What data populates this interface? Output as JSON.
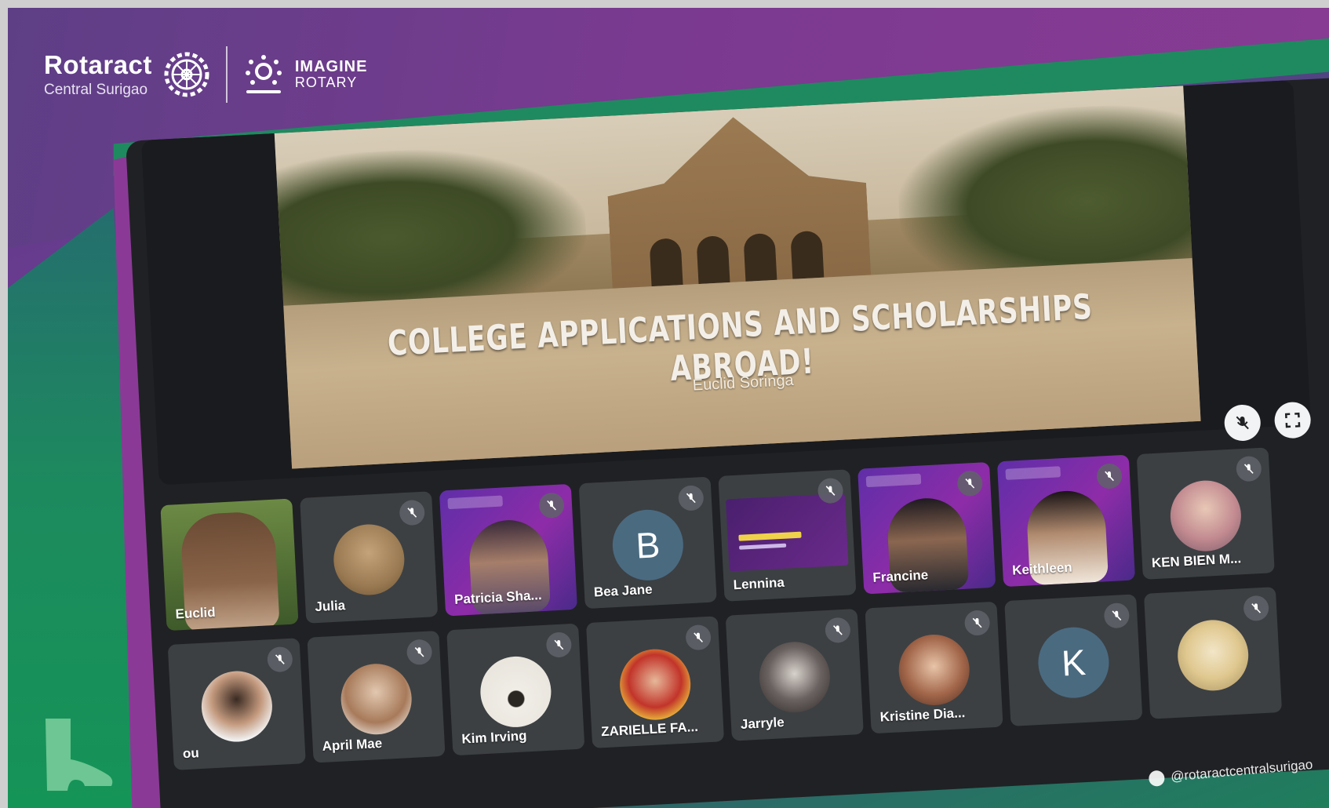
{
  "branding": {
    "org_name": "Rotaract",
    "org_location": "Central Surigao",
    "campaign_line1": "IMAGINE",
    "campaign_line2": "ROTARY"
  },
  "presentation": {
    "title": "COLLEGE APPLICATIONS AND SCHOLARSHIPS ABROAD!",
    "presenter": "Euclid Soringa"
  },
  "participants_row1": [
    {
      "name": "Euclid"
    },
    {
      "name": "Julia"
    },
    {
      "name": "Patricia Sha..."
    },
    {
      "name": "Bea Jane",
      "initial": "B"
    },
    {
      "name": "Lennina"
    },
    {
      "name": "Francine"
    },
    {
      "name": "Keithleen"
    },
    {
      "name": "KEN BIEN M..."
    }
  ],
  "participants_row2": [
    {
      "name": "ou"
    },
    {
      "name": "April Mae"
    },
    {
      "name": "Kim Irving"
    },
    {
      "name": "ZARIELLE FA..."
    },
    {
      "name": "Jarryle"
    },
    {
      "name": "Kristine Dia..."
    },
    {
      "name": "",
      "initial": "K"
    },
    {
      "name": ""
    }
  ],
  "watermark": "@rotaractcentralsurigao",
  "colors": {
    "purple": "#7a3a90",
    "green": "#1f8a5f",
    "meet_bg": "#202124",
    "tile_bg": "#3c4043"
  }
}
